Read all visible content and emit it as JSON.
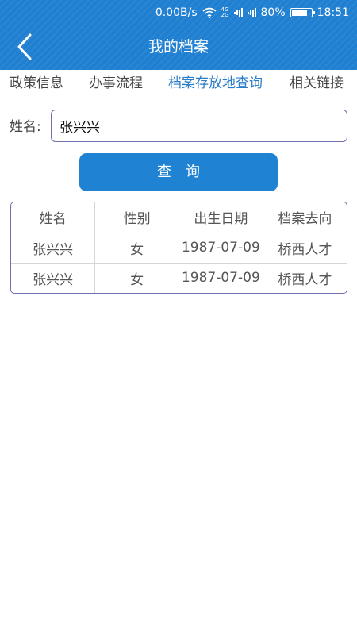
{
  "status_bar": {
    "net_speed": "0.00B/s",
    "net_type_top": "4G",
    "net_type_bottom": "2G",
    "battery_percent": "80%",
    "battery_level": 0.8,
    "time": "18:51"
  },
  "header": {
    "title": "我的档案",
    "back_icon": "chevron-left-icon",
    "color": "#1f7fd1"
  },
  "tabs": [
    {
      "label": "政策信息",
      "active": false
    },
    {
      "label": "办事流程",
      "active": false
    },
    {
      "label": "档案存放地查询",
      "active": true
    },
    {
      "label": "相关链接",
      "active": false
    }
  ],
  "search": {
    "label": "姓名:",
    "value": "张兴兴",
    "button_label": "查询"
  },
  "table": {
    "columns": [
      "姓名",
      "性别",
      "出生日期",
      "档案去向"
    ],
    "rows": [
      [
        "张兴兴",
        "女",
        "1987-07-09",
        "桥西人才"
      ],
      [
        "张兴兴",
        "女",
        "1987-07-09",
        "桥西人才"
      ]
    ]
  },
  "colors": {
    "accent": "#1f82d2",
    "active_tab": "#2a7cc7",
    "border": "#6e6fae"
  }
}
